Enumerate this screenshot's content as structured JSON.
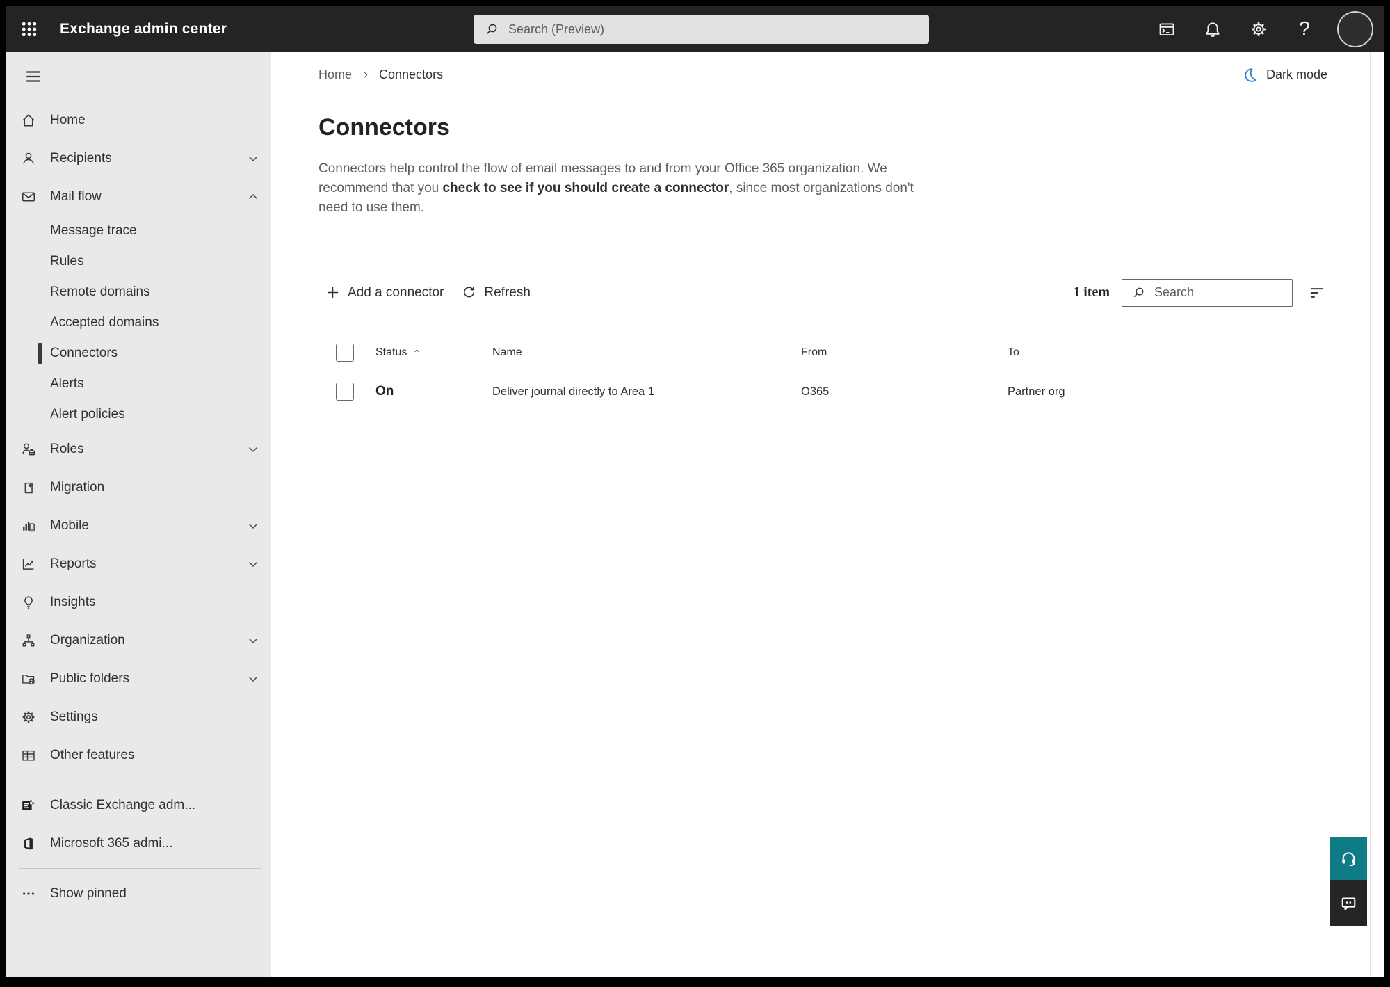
{
  "topbar": {
    "title": "Exchange admin center",
    "search_placeholder": "Search (Preview)",
    "help_glyph": "?",
    "icons": [
      "app-launcher",
      "search",
      "powershell-terminal",
      "notifications-bell",
      "settings-gear",
      "help",
      "account-avatar"
    ]
  },
  "sidebar": {
    "items": [
      {
        "label": "Home",
        "icon": "home",
        "chevron": null,
        "sub": false,
        "selected": false,
        "divider_before": false
      },
      {
        "label": "Recipients",
        "icon": "person",
        "chevron": "down",
        "sub": false,
        "selected": false,
        "divider_before": false
      },
      {
        "label": "Mail flow",
        "icon": "mail",
        "chevron": "up",
        "sub": false,
        "selected": false,
        "divider_before": false
      },
      {
        "label": "Message trace",
        "icon": null,
        "chevron": null,
        "sub": true,
        "selected": false,
        "divider_before": false
      },
      {
        "label": "Rules",
        "icon": null,
        "chevron": null,
        "sub": true,
        "selected": false,
        "divider_before": false
      },
      {
        "label": "Remote domains",
        "icon": null,
        "chevron": null,
        "sub": true,
        "selected": false,
        "divider_before": false
      },
      {
        "label": "Accepted domains",
        "icon": null,
        "chevron": null,
        "sub": true,
        "selected": false,
        "divider_before": false
      },
      {
        "label": "Connectors",
        "icon": null,
        "chevron": null,
        "sub": true,
        "selected": true,
        "divider_before": false
      },
      {
        "label": "Alerts",
        "icon": null,
        "chevron": null,
        "sub": true,
        "selected": false,
        "divider_before": false
      },
      {
        "label": "Alert policies",
        "icon": null,
        "chevron": null,
        "sub": true,
        "selected": false,
        "divider_before": false
      },
      {
        "label": "Roles",
        "icon": "roles",
        "chevron": "down",
        "sub": false,
        "selected": false,
        "divider_before": false
      },
      {
        "label": "Migration",
        "icon": "migration",
        "chevron": null,
        "sub": false,
        "selected": false,
        "divider_before": false
      },
      {
        "label": "Mobile",
        "icon": "mobile",
        "chevron": "down",
        "sub": false,
        "selected": false,
        "divider_before": false
      },
      {
        "label": "Reports",
        "icon": "reports",
        "chevron": "down",
        "sub": false,
        "selected": false,
        "divider_before": false
      },
      {
        "label": "Insights",
        "icon": "insights",
        "chevron": null,
        "sub": false,
        "selected": false,
        "divider_before": false
      },
      {
        "label": "Organization",
        "icon": "organization",
        "chevron": "down",
        "sub": false,
        "selected": false,
        "divider_before": false
      },
      {
        "label": "Public folders",
        "icon": "public-folders",
        "chevron": "down",
        "sub": false,
        "selected": false,
        "divider_before": false
      },
      {
        "label": "Settings",
        "icon": "gear",
        "chevron": null,
        "sub": false,
        "selected": false,
        "divider_before": false
      },
      {
        "label": "Other features",
        "icon": "grid",
        "chevron": null,
        "sub": false,
        "selected": false,
        "divider_before": false
      },
      {
        "label": "Classic Exchange adm...",
        "icon": "exchange-logo",
        "chevron": null,
        "sub": false,
        "selected": false,
        "divider_before": true
      },
      {
        "label": "Microsoft 365 admi...",
        "icon": "office-logo",
        "chevron": null,
        "sub": false,
        "selected": false,
        "divider_before": false
      },
      {
        "label": "Show pinned",
        "icon": "ellipsis",
        "chevron": null,
        "sub": false,
        "selected": false,
        "divider_before": true
      }
    ]
  },
  "breadcrumb": {
    "items": [
      "Home",
      "Connectors"
    ]
  },
  "dark_mode": {
    "label": "Dark mode"
  },
  "page": {
    "title": "Connectors",
    "description_before": "Connectors help control the flow of email messages to and from your Office 365 organization. We recommend that you ",
    "description_link": "check to see if you should create a connector",
    "description_after": ", since most organizations don't need to use them."
  },
  "toolbar": {
    "add_label": "Add a connector",
    "refresh_label": "Refresh",
    "item_count": "1 item",
    "search_placeholder": "Search"
  },
  "table": {
    "headers": [
      "Status",
      "Name",
      "From",
      "To"
    ],
    "sort": {
      "column": "Status",
      "direction": "ascending"
    },
    "rows": [
      {
        "status": "On",
        "name": "Deliver journal directly to Area 1",
        "from": "O365",
        "to": "Partner org"
      }
    ]
  },
  "floating_buttons": [
    "help-headset",
    "feedback-bubble"
  ],
  "colors": {
    "topbar_bg": "#242424",
    "sidebar_bg": "#e9e9e9",
    "selected_indicator": "#3a3a38",
    "accent_teal": "#0f7b84",
    "feedback_dark": "#262524",
    "moon_blue": "#2b7cd3"
  }
}
